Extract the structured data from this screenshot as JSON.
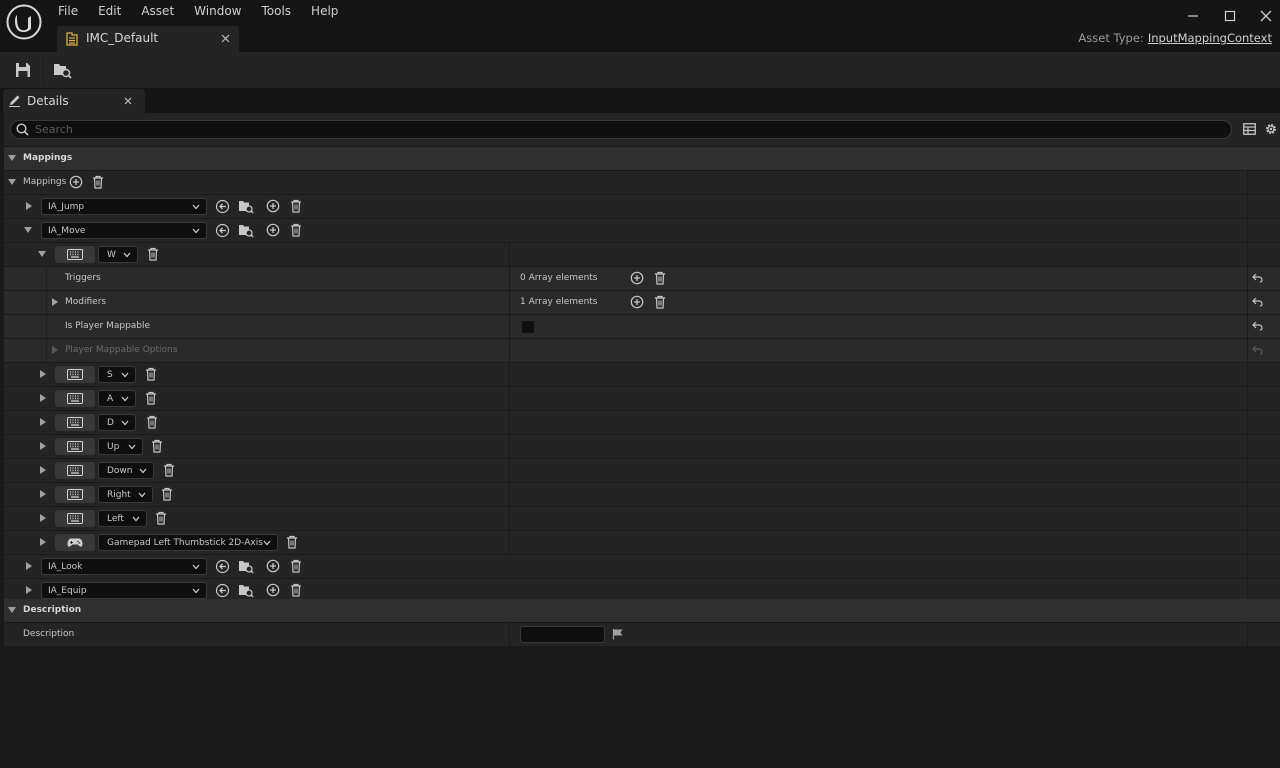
{
  "menu": [
    "File",
    "Edit",
    "Asset",
    "Window",
    "Tools",
    "Help"
  ],
  "document_tab": {
    "label": "IMC_Default"
  },
  "asset_type": {
    "label": "Asset Type:",
    "value": "InputMappingContext"
  },
  "details_tab": {
    "label": "Details"
  },
  "search": {
    "placeholder": "Search"
  },
  "sections": {
    "mappings": "Mappings",
    "mappings_array": "Mappings",
    "description": "Description"
  },
  "actions": {
    "jump": "IA_Jump",
    "move": "IA_Move",
    "look": "IA_Look",
    "equip": "IA_Equip"
  },
  "move_keys": [
    {
      "key": "W",
      "device": "keyboard"
    },
    {
      "key": "S",
      "device": "keyboard"
    },
    {
      "key": "A",
      "device": "keyboard"
    },
    {
      "key": "D",
      "device": "keyboard"
    },
    {
      "key": "Up",
      "device": "keyboard"
    },
    {
      "key": "Down",
      "device": "keyboard"
    },
    {
      "key": "Right",
      "device": "keyboard"
    },
    {
      "key": "Left",
      "device": "keyboard"
    },
    {
      "key": "Gamepad Left Thumbstick 2D-Axis",
      "device": "gamepad"
    }
  ],
  "w_properties": {
    "triggers_label": "Triggers",
    "triggers_value": "0 Array elements",
    "modifiers_label": "Modifiers",
    "modifiers_value": "1 Array elements",
    "player_mappable_label": "Is Player Mappable",
    "player_mappable_checked": false,
    "player_mappable_options_label": "Player Mappable Options"
  },
  "description": {
    "label": "Description",
    "value": ""
  },
  "icons": {
    "logo": "unreal-logo-icon",
    "tab": "input-mapping-context-icon",
    "save": "save-icon",
    "browse": "browse-to-asset-icon",
    "details": "pencil-icon",
    "search": "search-icon",
    "table": "table-view-icon",
    "settings": "gear-icon"
  }
}
